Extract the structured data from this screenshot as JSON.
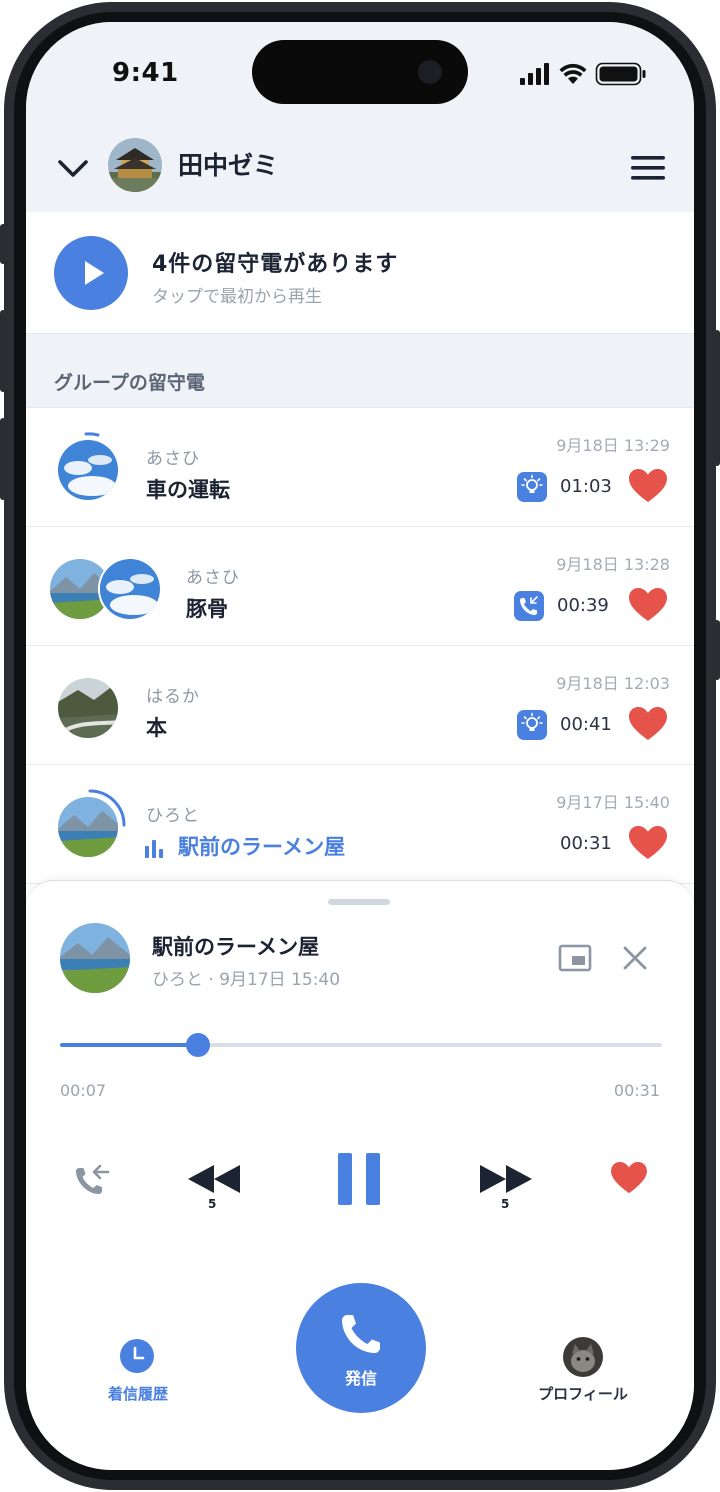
{
  "status_bar": {
    "time": "9:41"
  },
  "header": {
    "group_name": "田中ゼミ"
  },
  "voicemail_banner": {
    "title": "4件の留守電があります",
    "subtitle": "タップで最初から再生"
  },
  "section": {
    "label": "グループの留守電"
  },
  "messages": [
    {
      "sender": "あさひ",
      "title": "車の運転",
      "date": "9月18日 13:29",
      "duration": "01:03",
      "tag_icon": "lightbulb-icon",
      "liked": true
    },
    {
      "sender": "あさひ",
      "title": "豚骨",
      "date": "9月18日 13:28",
      "duration": "00:39",
      "tag_icon": "phone-callback-icon",
      "liked": true
    },
    {
      "sender": "はるか",
      "title": "本",
      "date": "9月18日 12:03",
      "duration": "00:41",
      "tag_icon": "lightbulb-icon",
      "liked": true
    },
    {
      "sender": "ひろと",
      "title": "駅前のラーメン屋",
      "date": "9月17日 15:40",
      "duration": "00:31",
      "tag_icon": "",
      "liked": true,
      "playing": true
    }
  ],
  "player": {
    "title": "駅前のラーメン屋",
    "subtitle": "ひろと · 9月17日 15:40",
    "current_time": "00:07",
    "total_time": "00:31",
    "progress": 0.23,
    "rewind_seconds": "5",
    "forward_seconds": "5"
  },
  "tabs": {
    "history_label": "着信履歴",
    "call_label": "発信",
    "profile_label": "プロフィール"
  },
  "colors": {
    "accent": "#4a80df",
    "heart": "#e5534b",
    "text_primary": "#1c2333",
    "text_muted": "#9aa3ae"
  }
}
